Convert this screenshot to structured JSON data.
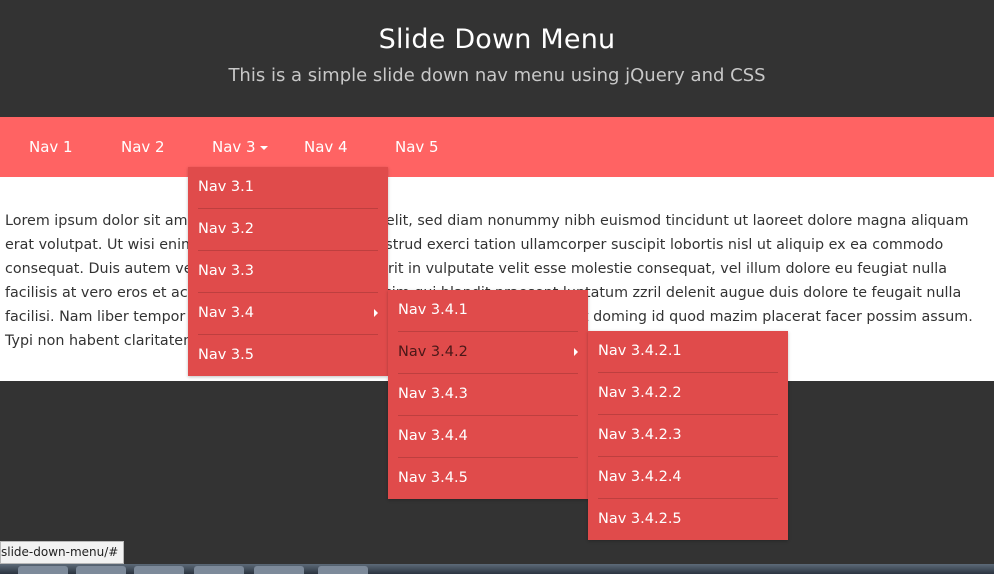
{
  "header": {
    "title": "Slide Down Menu",
    "subtitle": "This is a simple slide down nav menu using jQuery and CSS"
  },
  "nav": {
    "items": [
      {
        "label": "Nav 1"
      },
      {
        "label": "Nav 2"
      },
      {
        "label": "Nav 3"
      },
      {
        "label": "Nav 4"
      },
      {
        "label": "Nav 5"
      }
    ]
  },
  "submenu_nav3": {
    "items": [
      {
        "label": "Nav 3.1"
      },
      {
        "label": "Nav 3.2"
      },
      {
        "label": "Nav 3.3"
      },
      {
        "label": "Nav 3.4"
      },
      {
        "label": "Nav 3.5"
      }
    ]
  },
  "submenu_nav34": {
    "items": [
      {
        "label": "Nav 3.4.1"
      },
      {
        "label": "Nav 3.4.2"
      },
      {
        "label": "Nav 3.4.3"
      },
      {
        "label": "Nav 3.4.4"
      },
      {
        "label": "Nav 3.4.5"
      }
    ]
  },
  "submenu_nav342": {
    "items": [
      {
        "label": "Nav 3.4.2.1"
      },
      {
        "label": "Nav 3.4.2.2"
      },
      {
        "label": "Nav 3.4.2.3"
      },
      {
        "label": "Nav 3.4.2.4"
      },
      {
        "label": "Nav 3.4.2.5"
      }
    ]
  },
  "content": {
    "paragraph": "Lorem ipsum dolor sit amet, consectetuer adipiscing elit, sed diam nonummy nibh euismod tincidunt ut laoreet dolore magna aliquam erat volutpat. Ut wisi enim ad minim veniam, quis nostrud exerci tation ullamcorper suscipit lobortis nisl ut aliquip ex ea commodo consequat. Duis autem vel eum iriure dolor in hendrerit in vulputate velit esse molestie consequat, vel illum dolore eu feugiat nulla facilisis at vero eros et accumsan et iusto odio dignissim qui blandit praesent luptatum zzril delenit augue duis dolore te feugait nulla facilisi. Nam liber tempor cum soluta nobis eleifend option congue nihil imperdiet doming id quod mazim placerat facer possim assum. Typi non habent claritatem insitam;"
  },
  "status": {
    "url_tooltip": "slide-down-menu/#"
  },
  "colors": {
    "nav_background": "#ff6363",
    "submenu_background": "#e04b4b",
    "page_background": "#333333"
  },
  "icons": {
    "dropdown": "caret-down-icon",
    "submenu": "caret-right-icon"
  }
}
